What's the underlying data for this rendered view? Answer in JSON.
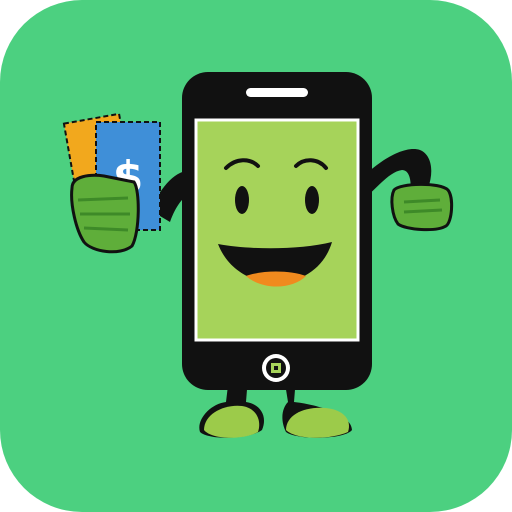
{
  "app_icon": {
    "icon_name": "phone-mascot-with-cash-icon",
    "background_color": "#4CD080",
    "colors": {
      "phone_body": "#111111",
      "screen": "#A6D35A",
      "screen_border": "#FFFFFF",
      "hand": "#5FAE3A",
      "hand_shade": "#3E8A28",
      "feet": "#9CCB4A",
      "ticket_blue": "#3F8FD8",
      "ticket_yellow": "#F2A81D",
      "mouth_tongue": "#F08A1E"
    },
    "ticket_symbol": "$"
  }
}
